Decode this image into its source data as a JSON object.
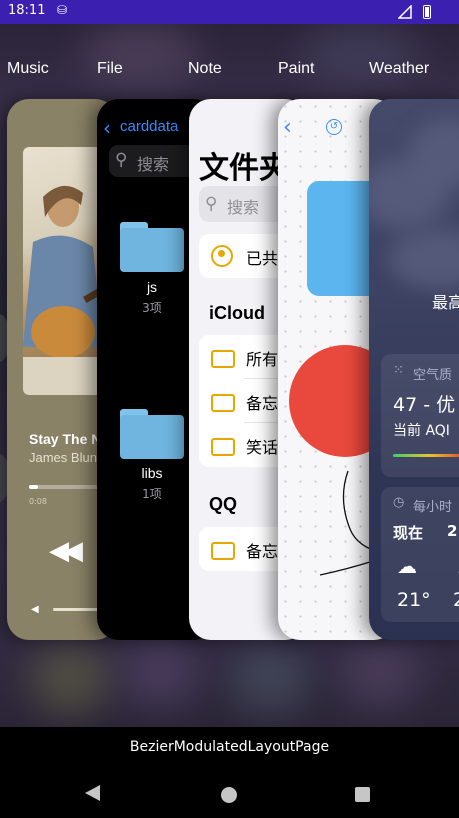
{
  "status_bar": {
    "time": "18:11",
    "sim_icon": "sim-card-icon"
  },
  "tabs": [
    "Music",
    "File",
    "Note",
    "Paint",
    "Weather"
  ],
  "music_card": {
    "song_title": "Stay The Night",
    "artist": "James Blunt",
    "elapsed": "0:08",
    "progress": 0.1
  },
  "file_card": {
    "back_label": "carddata",
    "search_placeholder": "搜索",
    "folders": [
      {
        "name": "js",
        "count": "3项"
      },
      {
        "name": "libs",
        "count": "1项"
      }
    ]
  },
  "note_card": {
    "heading": "文件夹",
    "search_placeholder": "搜索",
    "shared_row": "已共享",
    "sections": [
      {
        "title": "iCloud",
        "rows": [
          "所有",
          "备忘",
          "笑话"
        ]
      },
      {
        "title": "QQ",
        "rows": [
          "备忘"
        ]
      }
    ]
  },
  "paint_card": {
    "shapes": [
      "blue-rounded-rect",
      "red-circle",
      "black-stroke"
    ]
  },
  "weather_card": {
    "highlight": "最高",
    "aqi_label": "空气质",
    "aqi_value": "47 - 优",
    "aqi_now": "当前 AQI",
    "hourly_label": "每小时",
    "col_now": "现在",
    "col_next": "2",
    "temp_now": "21°",
    "temp_next": "2"
  },
  "page_label": "BezierModulatedLayoutPage",
  "colors": {
    "status_bar": "#3a1fb0",
    "link_blue": "#3a8bff",
    "folder_blue": "#6fb5df",
    "note_yellow": "#e8a600",
    "paint_red": "#e9483c",
    "paint_blue": "#5cb5ef"
  }
}
